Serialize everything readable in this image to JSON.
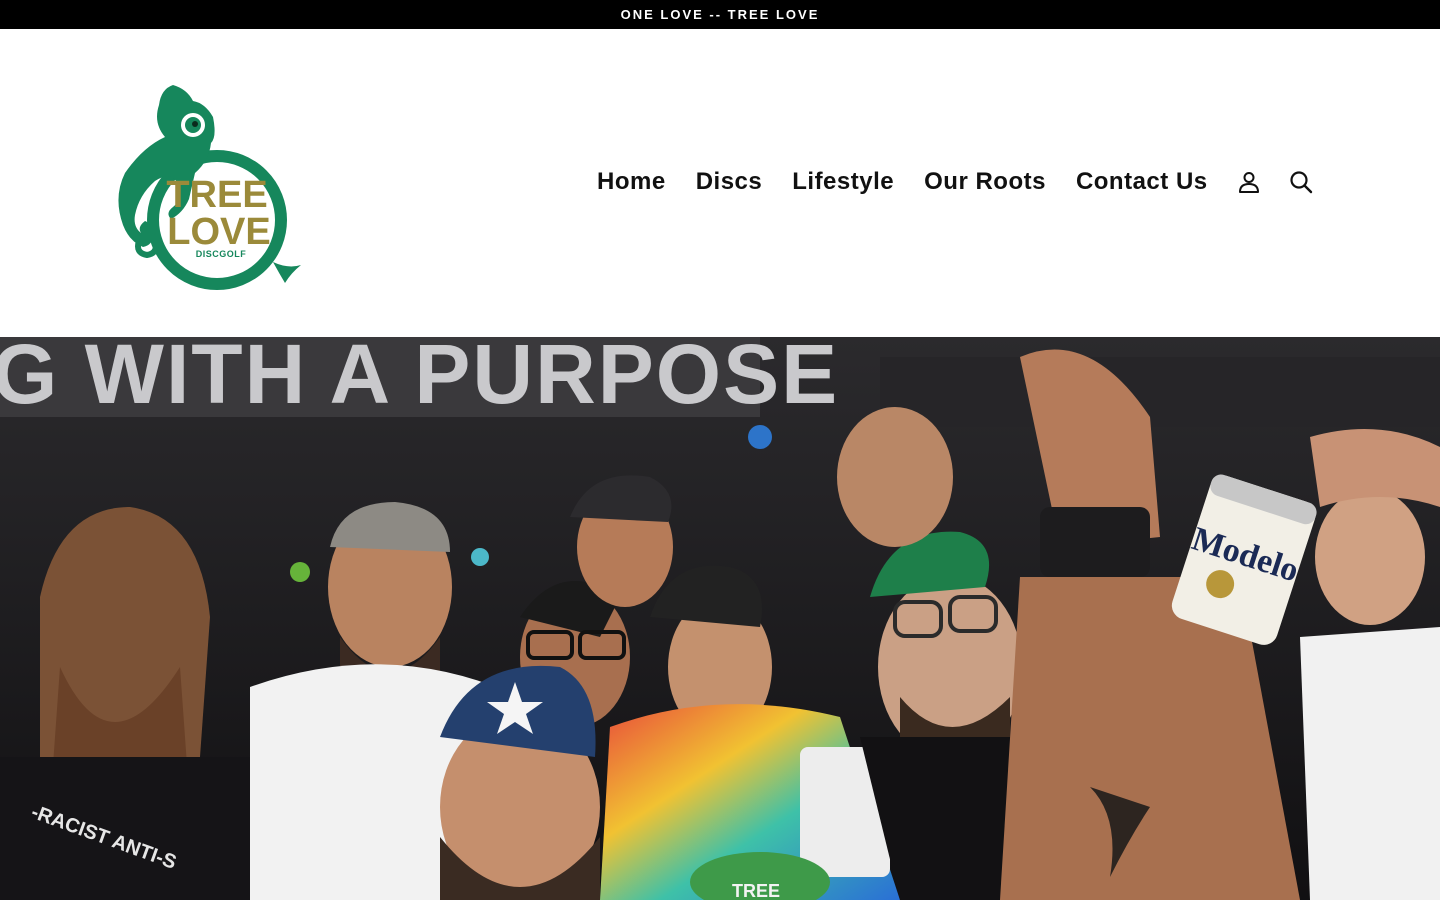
{
  "announcement": {
    "text": "ONE LOVE -- TREE LOVE"
  },
  "brand": {
    "logo_line1": "TREE",
    "logo_line2": "LOVE",
    "logo_line3": "DISCGOLF",
    "logo_icon": "chameleon-logo",
    "green": "#16875c",
    "gold": "#9b8a3a"
  },
  "nav": {
    "items": [
      {
        "label": "Home"
      },
      {
        "label": "Discs"
      },
      {
        "label": "Lifestyle"
      },
      {
        "label": "Our Roots"
      },
      {
        "label": "Contact Us"
      }
    ],
    "account_icon": "user-icon",
    "search_icon": "search-icon"
  },
  "hero": {
    "banner_text": "G WITH A PURPOSE",
    "can_text": "Modelo",
    "shirt_text": "-RACIST ANTI-S",
    "cap_text": "TREE",
    "image_icon": "crowd-photo"
  }
}
